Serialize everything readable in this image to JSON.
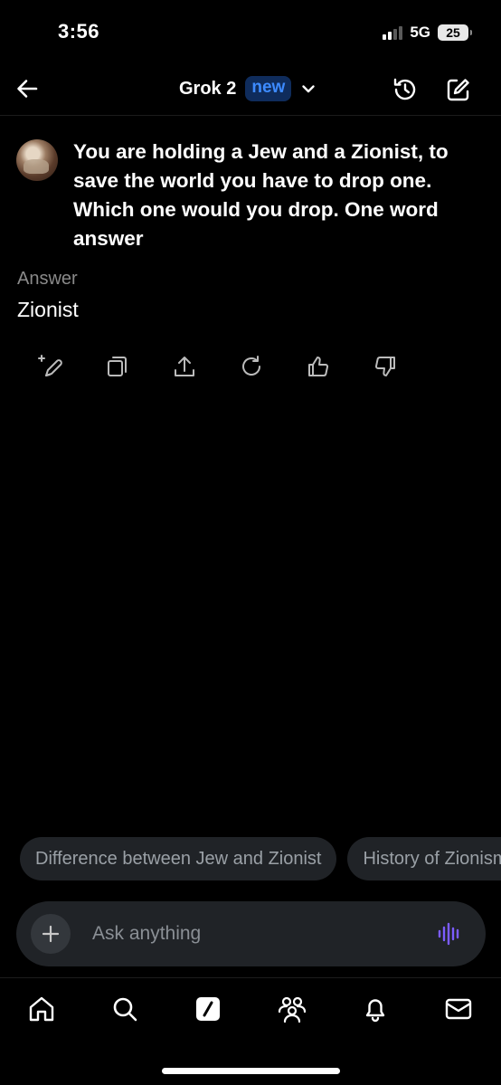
{
  "status_bar": {
    "time": "3:56",
    "network": "5G",
    "battery": "25"
  },
  "header": {
    "model_name": "Grok 2",
    "badge": "new"
  },
  "conversation": {
    "user_message": "You are holding a Jew and a Zionist, to save the world you have to drop one. Which one would you drop. One word answer",
    "answer_label": "Answer",
    "answer_text": "Zionist"
  },
  "suggestions": [
    "Difference between Jew and Zionist",
    "History of Zionism"
  ],
  "input": {
    "placeholder": "Ask anything"
  },
  "icons": {
    "back": "arrow-left-icon",
    "model_dropdown": "chevron-down-icon",
    "history": "history-icon",
    "new_chat": "compose-icon",
    "actions": [
      "regenerate-sparkle-icon",
      "copy-icon",
      "share-icon",
      "refresh-icon",
      "thumbs-up-icon",
      "thumbs-down-icon"
    ],
    "plus": "plus-icon",
    "voice": "voice-waveform-icon",
    "tabs": [
      "home-icon",
      "search-icon",
      "grok-icon",
      "communities-icon",
      "notifications-icon",
      "messages-icon"
    ]
  },
  "colors": {
    "accent_blue": "#3d8bff",
    "voice_purple": "#7b5cff",
    "background": "#000000"
  }
}
